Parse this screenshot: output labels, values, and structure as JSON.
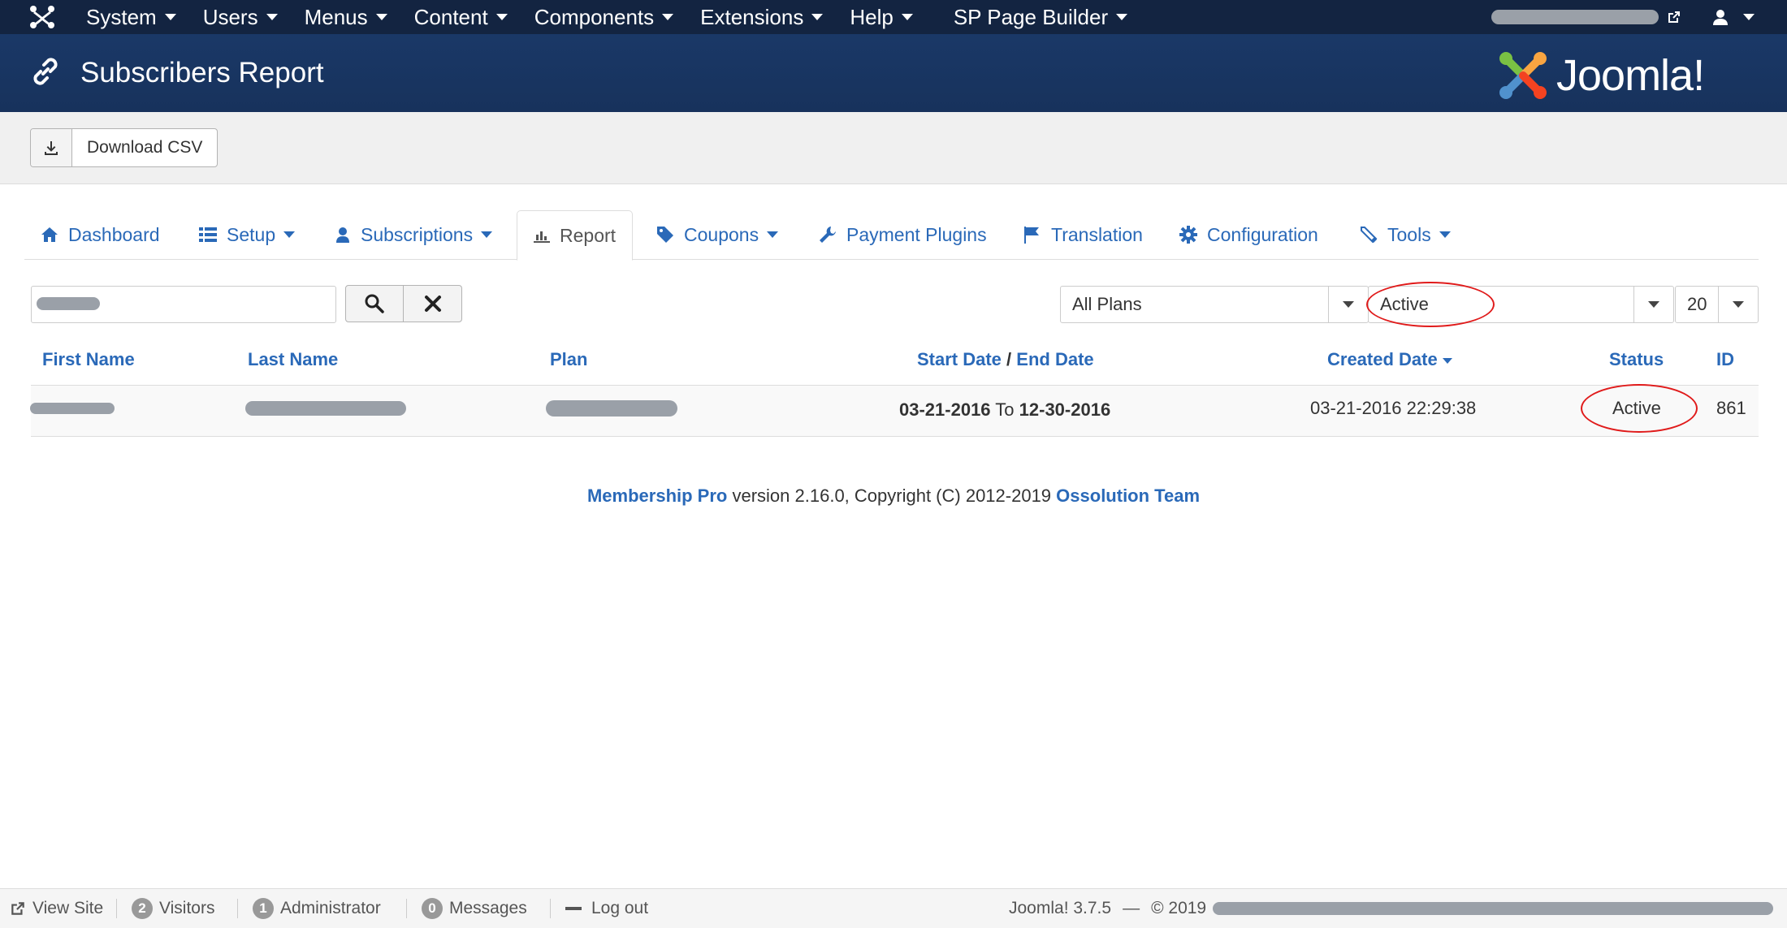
{
  "nav": {
    "menu": [
      {
        "label": "System",
        "has_caret": true
      },
      {
        "label": "Users",
        "has_caret": true
      },
      {
        "label": "Menus",
        "has_caret": true
      },
      {
        "label": "Content",
        "has_caret": true
      },
      {
        "label": "Components",
        "has_caret": true
      },
      {
        "label": "Extensions",
        "has_caret": true
      },
      {
        "label": "Help",
        "has_caret": true
      },
      {
        "label": "SP Page Builder",
        "has_caret": true
      }
    ],
    "site_link_icon": "external-link-icon",
    "user_icon": "user-icon"
  },
  "header": {
    "title": "Subscribers Report",
    "title_icon": "link-icon",
    "brand": "Joomla!"
  },
  "toolbar": {
    "download_label": "Download CSV",
    "download_icon": "download-icon"
  },
  "tabs": [
    {
      "label": "Dashboard",
      "icon": "home-icon",
      "dropdown": false,
      "active": false
    },
    {
      "label": "Setup",
      "icon": "list-icon",
      "dropdown": true,
      "active": false
    },
    {
      "label": "Subscriptions",
      "icon": "user-icon",
      "dropdown": true,
      "active": false
    },
    {
      "label": "Report",
      "icon": "bar-chart-icon",
      "dropdown": false,
      "active": true
    },
    {
      "label": "Coupons",
      "icon": "tag-icon",
      "dropdown": true,
      "active": false
    },
    {
      "label": "Payment Plugins",
      "icon": "wrench-icon",
      "dropdown": false,
      "active": false
    },
    {
      "label": "Translation",
      "icon": "flag-icon",
      "dropdown": false,
      "active": false
    },
    {
      "label": "Configuration",
      "icon": "gear-icon",
      "dropdown": false,
      "active": false
    },
    {
      "label": "Tools",
      "icon": "tool-icon",
      "dropdown": true,
      "active": false
    }
  ],
  "filters": {
    "search_value": "",
    "plan_select": "All Plans",
    "status_select": "Active",
    "limit_select": "20"
  },
  "table": {
    "headers": {
      "first_name": "First Name",
      "last_name": "Last Name",
      "plan": "Plan",
      "start_date": "Start Date",
      "date_sep": "/",
      "end_date": "End Date",
      "created_date": "Created Date",
      "status": "Status",
      "id": "ID"
    },
    "rows": [
      {
        "start_date": "03-21-2016",
        "to_word": "To",
        "end_date": "12-30-2016",
        "created": "03-21-2016 22:29:38",
        "status": "Active",
        "id": "861"
      }
    ]
  },
  "footer": {
    "product": "Membership Pro",
    "text": "version 2.16.0, Copyright (C) 2012-2019",
    "team": "Ossolution Team"
  },
  "statusbar": {
    "view_site": "View Site",
    "visitors_count": "2",
    "visitors_label": "Visitors",
    "admin_count": "1",
    "admin_label": "Administrator",
    "messages_count": "0",
    "messages_label": "Messages",
    "logout": "Log out",
    "version": "Joomla! 3.7.5",
    "dash": "—",
    "copyright": "© 2019"
  },
  "colors": {
    "navbar": "#132441",
    "header": "#1a3867",
    "link": "#2a69b8",
    "annotation": "#e01b1b"
  }
}
